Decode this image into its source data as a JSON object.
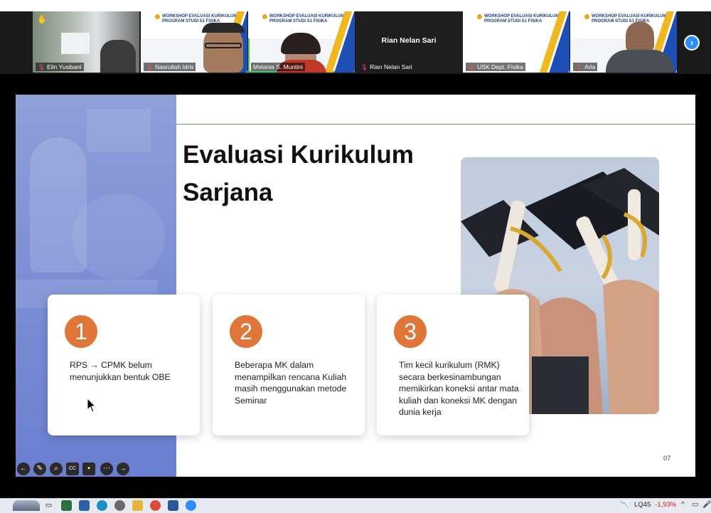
{
  "participants": [
    {
      "name": "Elin Yusibani",
      "type": "video"
    },
    {
      "name": "Nasrullah Idris",
      "type": "video",
      "header_line1": "WORKSHOP EVALUASI KURIKULUM",
      "header_line2": "PROGRAM STUDI S1 FISIKA"
    },
    {
      "name": "Melania S. Muntini",
      "type": "video",
      "header_line1": "WORKSHOP EVALUASI KURIKULUM",
      "header_line2": "PROGRAM STUDI S1 FISIKA"
    },
    {
      "name": "Rian Nelan Sari",
      "type": "name-only",
      "big_name": "Rian Nelan Sari"
    },
    {
      "name": "USK Dept. Fisika",
      "type": "video",
      "header_line1": "WORKSHOP EVALUASI KURIKULUM",
      "header_line2": "PROGRAM STUDI S1 FISIKA"
    },
    {
      "name": "Arla",
      "type": "video",
      "header_line1": "WORKSHOP EVALUASI KURIKULUM",
      "header_line2": "PROGRAM STUDI S1 FISIKA"
    }
  ],
  "slide": {
    "title_line1": "Evaluasi Kurikulum",
    "title_line2": "Sarjana",
    "page_number": "07",
    "cards": [
      {
        "number": "1",
        "text": "RPS → CPMK belum menunjukkan bentuk OBE"
      },
      {
        "number": "2",
        "text": "Beberapa MK dalam menampilkan rencana Kuliah masih menggunakan metode Seminar"
      },
      {
        "number": "3",
        "text": "Tim kecil kurikulum (RMK) secara berkesinambungan memikirkan koneksi antar mata kuliah dan koneksi MK dengan dunia kerja"
      }
    ]
  },
  "taskbar": {
    "stock_name": "LQ45",
    "stock_change": "-1,93%"
  },
  "colors": {
    "accent_orange": "#e0753a",
    "zoom_blue": "#2d8cff",
    "slide_panel": "#7b8ed6"
  }
}
